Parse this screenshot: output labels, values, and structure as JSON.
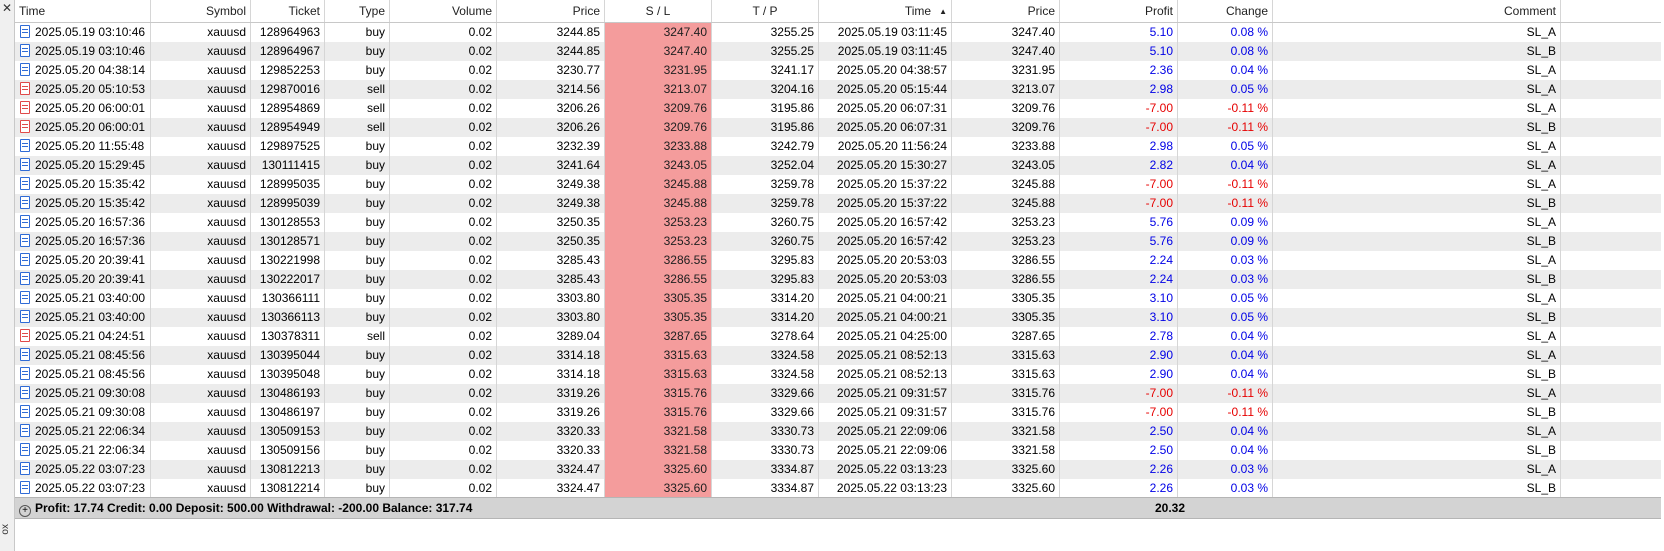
{
  "side_panel": {
    "close_glyph": "✕",
    "title": "ox"
  },
  "columns": [
    "Time",
    "Symbol",
    "Ticket",
    "Type",
    "Volume",
    "Price",
    "S / L",
    "T / P",
    "Time",
    "Price",
    "Profit",
    "Change",
    "Comment"
  ],
  "sort_glyph": "▲",
  "rows": [
    [
      "2025.05.19 03:10:46",
      "xauusd",
      "128964963",
      "buy",
      "0.02",
      "3244.85",
      "3247.40",
      "3255.25",
      "2025.05.19 03:11:45",
      "3247.40",
      "5.10",
      "0.08 %",
      "SL_A"
    ],
    [
      "2025.05.19 03:10:46",
      "xauusd",
      "128964967",
      "buy",
      "0.02",
      "3244.85",
      "3247.40",
      "3255.25",
      "2025.05.19 03:11:45",
      "3247.40",
      "5.10",
      "0.08 %",
      "SL_B"
    ],
    [
      "2025.05.20 04:38:14",
      "xauusd",
      "129852253",
      "buy",
      "0.02",
      "3230.77",
      "3231.95",
      "3241.17",
      "2025.05.20 04:38:57",
      "3231.95",
      "2.36",
      "0.04 %",
      "SL_A"
    ],
    [
      "2025.05.20 05:10:53",
      "xauusd",
      "129870016",
      "sell",
      "0.02",
      "3214.56",
      "3213.07",
      "3204.16",
      "2025.05.20 05:15:44",
      "3213.07",
      "2.98",
      "0.05 %",
      "SL_A"
    ],
    [
      "2025.05.20 06:00:01",
      "xauusd",
      "128954869",
      "sell",
      "0.02",
      "3206.26",
      "3209.76",
      "3195.86",
      "2025.05.20 06:07:31",
      "3209.76",
      "-7.00",
      "-0.11 %",
      "SL_A"
    ],
    [
      "2025.05.20 06:00:01",
      "xauusd",
      "128954949",
      "sell",
      "0.02",
      "3206.26",
      "3209.76",
      "3195.86",
      "2025.05.20 06:07:31",
      "3209.76",
      "-7.00",
      "-0.11 %",
      "SL_B"
    ],
    [
      "2025.05.20 11:55:48",
      "xauusd",
      "129897525",
      "buy",
      "0.02",
      "3232.39",
      "3233.88",
      "3242.79",
      "2025.05.20 11:56:24",
      "3233.88",
      "2.98",
      "0.05 %",
      "SL_A"
    ],
    [
      "2025.05.20 15:29:45",
      "xauusd",
      "130111415",
      "buy",
      "0.02",
      "3241.64",
      "3243.05",
      "3252.04",
      "2025.05.20 15:30:27",
      "3243.05",
      "2.82",
      "0.04 %",
      "SL_A"
    ],
    [
      "2025.05.20 15:35:42",
      "xauusd",
      "128995035",
      "buy",
      "0.02",
      "3249.38",
      "3245.88",
      "3259.78",
      "2025.05.20 15:37:22",
      "3245.88",
      "-7.00",
      "-0.11 %",
      "SL_A"
    ],
    [
      "2025.05.20 15:35:42",
      "xauusd",
      "128995039",
      "buy",
      "0.02",
      "3249.38",
      "3245.88",
      "3259.78",
      "2025.05.20 15:37:22",
      "3245.88",
      "-7.00",
      "-0.11 %",
      "SL_B"
    ],
    [
      "2025.05.20 16:57:36",
      "xauusd",
      "130128553",
      "buy",
      "0.02",
      "3250.35",
      "3253.23",
      "3260.75",
      "2025.05.20 16:57:42",
      "3253.23",
      "5.76",
      "0.09 %",
      "SL_A"
    ],
    [
      "2025.05.20 16:57:36",
      "xauusd",
      "130128571",
      "buy",
      "0.02",
      "3250.35",
      "3253.23",
      "3260.75",
      "2025.05.20 16:57:42",
      "3253.23",
      "5.76",
      "0.09 %",
      "SL_B"
    ],
    [
      "2025.05.20 20:39:41",
      "xauusd",
      "130221998",
      "buy",
      "0.02",
      "3285.43",
      "3286.55",
      "3295.83",
      "2025.05.20 20:53:03",
      "3286.55",
      "2.24",
      "0.03 %",
      "SL_A"
    ],
    [
      "2025.05.20 20:39:41",
      "xauusd",
      "130222017",
      "buy",
      "0.02",
      "3285.43",
      "3286.55",
      "3295.83",
      "2025.05.20 20:53:03",
      "3286.55",
      "2.24",
      "0.03 %",
      "SL_B"
    ],
    [
      "2025.05.21 03:40:00",
      "xauusd",
      "130366111",
      "buy",
      "0.02",
      "3303.80",
      "3305.35",
      "3314.20",
      "2025.05.21 04:00:21",
      "3305.35",
      "3.10",
      "0.05 %",
      "SL_A"
    ],
    [
      "2025.05.21 03:40:00",
      "xauusd",
      "130366113",
      "buy",
      "0.02",
      "3303.80",
      "3305.35",
      "3314.20",
      "2025.05.21 04:00:21",
      "3305.35",
      "3.10",
      "0.05 %",
      "SL_B"
    ],
    [
      "2025.05.21 04:24:51",
      "xauusd",
      "130378311",
      "sell",
      "0.02",
      "3289.04",
      "3287.65",
      "3278.64",
      "2025.05.21 04:25:00",
      "3287.65",
      "2.78",
      "0.04 %",
      "SL_A"
    ],
    [
      "2025.05.21 08:45:56",
      "xauusd",
      "130395044",
      "buy",
      "0.02",
      "3314.18",
      "3315.63",
      "3324.58",
      "2025.05.21 08:52:13",
      "3315.63",
      "2.90",
      "0.04 %",
      "SL_A"
    ],
    [
      "2025.05.21 08:45:56",
      "xauusd",
      "130395048",
      "buy",
      "0.02",
      "3314.18",
      "3315.63",
      "3324.58",
      "2025.05.21 08:52:13",
      "3315.63",
      "2.90",
      "0.04 %",
      "SL_B"
    ],
    [
      "2025.05.21 09:30:08",
      "xauusd",
      "130486193",
      "buy",
      "0.02",
      "3319.26",
      "3315.76",
      "3329.66",
      "2025.05.21 09:31:57",
      "3315.76",
      "-7.00",
      "-0.11 %",
      "SL_A"
    ],
    [
      "2025.05.21 09:30:08",
      "xauusd",
      "130486197",
      "buy",
      "0.02",
      "3319.26",
      "3315.76",
      "3329.66",
      "2025.05.21 09:31:57",
      "3315.76",
      "-7.00",
      "-0.11 %",
      "SL_B"
    ],
    [
      "2025.05.21 22:06:34",
      "xauusd",
      "130509153",
      "buy",
      "0.02",
      "3320.33",
      "3321.58",
      "3330.73",
      "2025.05.21 22:09:06",
      "3321.58",
      "2.50",
      "0.04 %",
      "SL_A"
    ],
    [
      "2025.05.21 22:06:34",
      "xauusd",
      "130509156",
      "buy",
      "0.02",
      "3320.33",
      "3321.58",
      "3330.73",
      "2025.05.21 22:09:06",
      "3321.58",
      "2.50",
      "0.04 %",
      "SL_B"
    ],
    [
      "2025.05.22 03:07:23",
      "xauusd",
      "130812213",
      "buy",
      "0.02",
      "3324.47",
      "3325.60",
      "3334.87",
      "2025.05.22 03:13:23",
      "3325.60",
      "2.26",
      "0.03 %",
      "SL_A"
    ],
    [
      "2025.05.22 03:07:23",
      "xauusd",
      "130812214",
      "buy",
      "0.02",
      "3324.47",
      "3325.60",
      "3334.87",
      "2025.05.22 03:13:23",
      "3325.60",
      "2.26",
      "0.03 %",
      "SL_B"
    ]
  ],
  "footer": {
    "expand_glyph": "+",
    "summary": "Profit: 17.74  Credit: 0.00  Deposit: 500.00  Withdrawal: -200.00  Balance: 317.74",
    "total_profit": "20.32"
  },
  "colors": {
    "sl_highlight": "#f49c9c",
    "positive": "#0000e6",
    "negative": "#e60000",
    "buy_icon": "#2f6bd6",
    "sell_icon": "#e04a4a"
  }
}
